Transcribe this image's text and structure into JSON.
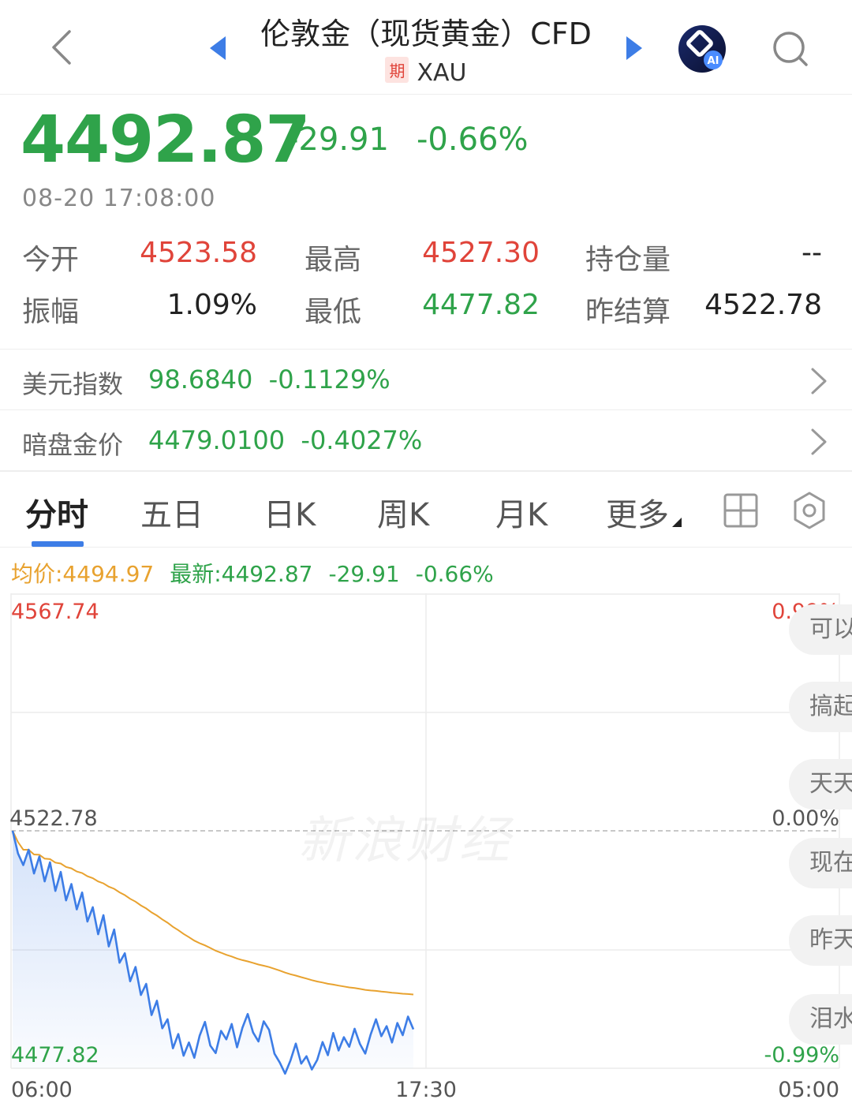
{
  "header": {
    "title": "伦敦金（现货黄金）CFD",
    "badge": "期",
    "symbol": "XAU"
  },
  "quote": {
    "price": "4492.87",
    "change": "-29.91",
    "change_pct": "-0.66%",
    "timestamp": "08-20 17:08:00"
  },
  "stats": {
    "open_label": "今开",
    "open_value": "4523.58",
    "high_label": "最高",
    "high_value": "4527.30",
    "oi_label": "持仓量",
    "oi_value": "--",
    "amp_label": "振幅",
    "amp_value": "1.09%",
    "low_label": "最低",
    "low_value": "4477.82",
    "settle_label": "昨结算",
    "settle_value": "4522.78"
  },
  "refs": [
    {
      "label": "美元指数",
      "value": "98.6840",
      "pct": "-0.1129%"
    },
    {
      "label": "暗盘金价",
      "value": "4479.0100",
      "pct": "-0.4027%"
    }
  ],
  "tabs": [
    "分时",
    "五日",
    "日K",
    "周K",
    "月K",
    "更多"
  ],
  "info": {
    "avg": "均价:4494.97",
    "latest": "最新:4492.87",
    "change": "-29.91",
    "pct": "-0.66%"
  },
  "chart_data": {
    "type": "line",
    "y_labels": {
      "max": "4567.74",
      "mid": "4522.78",
      "min": "4477.82"
    },
    "pct_labels": {
      "max": "0.99%",
      "mid": "0.00%",
      "min": "-0.99%"
    },
    "x_labels": [
      "06:00",
      "17:30",
      "05:00"
    ],
    "ylim": [
      4477.82,
      4567.74
    ],
    "grid": true,
    "colors": {
      "price": "#3d7de6",
      "avg": "#e8a22f"
    },
    "series": [
      {
        "values": [
          4522.8,
          4518.5,
          4516.3,
          4519.2,
          4514.7,
          4517.9,
          4513.2,
          4516.8,
          4511.4,
          4515.0,
          4509.6,
          4512.7,
          4507.9,
          4511.1,
          4505.6,
          4508.3,
          4503.2,
          4506.8,
          4500.9,
          4504.1,
          4497.8,
          4499.6,
          4494.3,
          4497.0,
          4491.7,
          4493.8,
          4487.9,
          4490.6,
          4485.4,
          4487.1,
          4481.6,
          4484.3,
          4480.2,
          4482.7,
          4479.8,
          4484.0,
          4486.6,
          4482.1,
          4480.7,
          4484.9,
          4483.3,
          4486.2,
          4481.8,
          4485.5,
          4488.1,
          4484.6,
          4482.9,
          4486.7,
          4485.1,
          4480.6,
          4478.9,
          4476.8,
          4479.3,
          4482.5,
          4478.7,
          4480.1,
          4477.6,
          4479.4,
          4482.8,
          4480.3,
          4484.5,
          4481.2,
          4483.7,
          4481.9,
          4485.3,
          4482.4,
          4480.6,
          4484.2,
          4487.1,
          4483.9,
          4485.8,
          4482.7,
          4486.4,
          4484.1,
          4487.6,
          4485.2
        ]
      }
    ]
  },
  "side_comments": [
    "可以",
    "搞起",
    "天天",
    "现在",
    "昨天",
    "泪水"
  ],
  "watermark": "新浪财经"
}
